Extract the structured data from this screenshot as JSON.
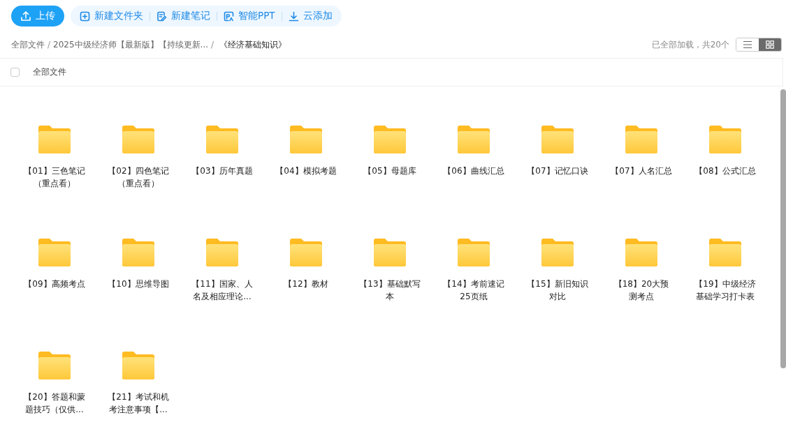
{
  "toolbar": {
    "upload": {
      "label": "上传"
    },
    "actions": [
      {
        "kind": "folder",
        "label": "新建文件夹"
      },
      {
        "kind": "note",
        "label": "新建笔记"
      },
      {
        "kind": "ppt",
        "label": "智能PPT"
      },
      {
        "kind": "download",
        "label": "云添加"
      }
    ]
  },
  "breadcrumb": [
    {
      "label": "全部文件",
      "current": false
    },
    {
      "separator": "/",
      "label": "2025中级经济师【最新版】【持续更新...",
      "current": false
    },
    {
      "separator": "/",
      "label": "《经济基础知识》",
      "current": true
    }
  ],
  "load_status": "已全部加载，共20个",
  "view_toggle": [
    {
      "kind": "list",
      "selected": false
    },
    {
      "kind": "grid",
      "selected": true
    }
  ],
  "header": {
    "checked": false,
    "label": "全部文件"
  },
  "folders": [
    {
      "name": "【01】三色笔记（重点看）"
    },
    {
      "name": "【02】四色笔记（重点看）"
    },
    {
      "name": "【03】历年真题"
    },
    {
      "name": "【04】模拟考题"
    },
    {
      "name": "【05】母题库"
    },
    {
      "name": "【06】曲线汇总"
    },
    {
      "name": "【07】记忆口诀"
    },
    {
      "name": "【07】人名汇总"
    },
    {
      "name": "【08】公式汇总"
    },
    {
      "name": "【09】高频考点"
    },
    {
      "name": "【10】思维导图"
    },
    {
      "name": "【11】国家、人名及相应理论..."
    },
    {
      "name": "【12】教材"
    },
    {
      "name": "【13】基础默写本"
    },
    {
      "name": "【14】考前速记25页纸"
    },
    {
      "name": "【15】新旧知识对比"
    },
    {
      "name": "【18】20大预测考点"
    },
    {
      "name": "【19】中级经济基础学习打卡表"
    },
    {
      "name": "【20】答题和蒙题技巧（仅供..."
    },
    {
      "name": "【21】考试和机考注意事项【..."
    }
  ]
}
